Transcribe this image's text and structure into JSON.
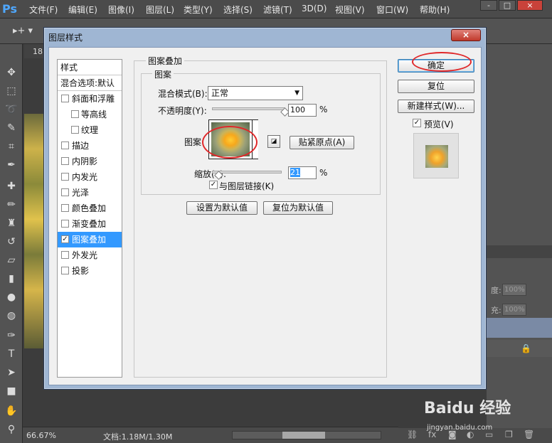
{
  "app": {
    "logo": "Ps",
    "menu": [
      "文件(F)",
      "编辑(E)",
      "图像(I)",
      "图层(L)",
      "类型(Y)",
      "选择(S)",
      "滤镜(T)",
      "3D(D)",
      "视图(V)",
      "窗口(W)",
      "帮助(H)"
    ],
    "window_buttons": {
      "minimize": "-",
      "maximize": "□",
      "close": "×"
    },
    "options_tool": "▸+ ▾",
    "doc_tab": "18",
    "statusbar": {
      "zoom": "66.67%",
      "doc": "文档:1.18M/1.30M"
    },
    "right_panel": {
      "opacity_label": "度:",
      "opacity_value": "100%",
      "fill_label": "充:",
      "fill_value": "100%"
    }
  },
  "dialog": {
    "title": "图层样式",
    "close_label": "×",
    "styles_header": "样式",
    "blend_options": "混合选项:默认",
    "style_items": [
      {
        "label": "斜面和浮雕",
        "checked": false,
        "indent": false
      },
      {
        "label": "等高线",
        "checked": false,
        "indent": true
      },
      {
        "label": "纹理",
        "checked": false,
        "indent": true
      },
      {
        "label": "描边",
        "checked": false,
        "indent": false
      },
      {
        "label": "内阴影",
        "checked": false,
        "indent": false
      },
      {
        "label": "内发光",
        "checked": false,
        "indent": false
      },
      {
        "label": "光泽",
        "checked": false,
        "indent": false
      },
      {
        "label": "颜色叠加",
        "checked": false,
        "indent": false
      },
      {
        "label": "渐变叠加",
        "checked": false,
        "indent": false
      },
      {
        "label": "图案叠加",
        "checked": true,
        "indent": false,
        "selected": true
      },
      {
        "label": "外发光",
        "checked": false,
        "indent": false
      },
      {
        "label": "投影",
        "checked": false,
        "indent": false
      }
    ],
    "section_title": "图案叠加",
    "subsection_title": "图案",
    "blend_mode_label": "混合模式(B):",
    "blend_mode_value": "正常",
    "opacity_label": "不透明度(Y):",
    "opacity_value": "100",
    "opacity_unit": "%",
    "opacity_fraction": 1.0,
    "pattern_label": "图案",
    "snap_origin_button": "贴紧原点(A)",
    "scale_label": "缩放(S):",
    "scale_value": "21",
    "scale_unit": "%",
    "scale_fraction": 0.02,
    "link_layer_label": "与图层链接(K)",
    "link_layer_checked": true,
    "make_default_button": "设置为默认值",
    "reset_default_button": "复位为默认值",
    "ok_button": "确定",
    "reset_button": "复位",
    "new_style_button": "新建样式(W)...",
    "preview_label": "预览(V)",
    "preview_checked": true
  },
  "watermark": {
    "brand": "Baidu 经验",
    "sub": "jingyan.baidu.com"
  },
  "colors": {
    "highlight": "#3399ff",
    "annotation_red": "#e0282a",
    "dialog_frame": "#9fb6d3"
  }
}
